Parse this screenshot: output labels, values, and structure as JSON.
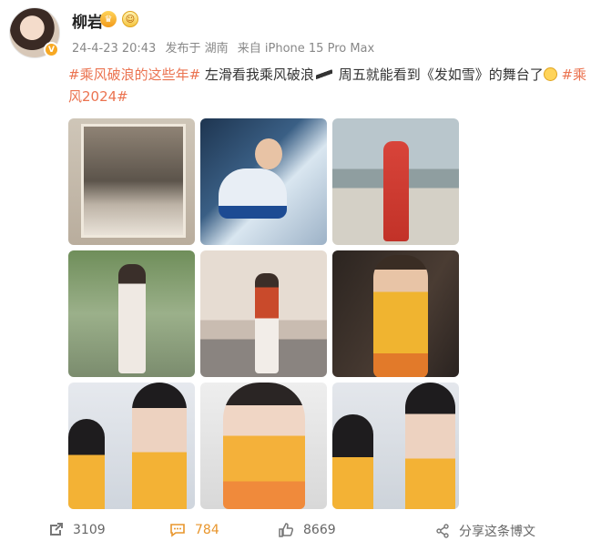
{
  "post": {
    "username": "柳岩",
    "time": "24-4-23 20:43",
    "location": "发布于 湖南",
    "source": "来自 iPhone 15 Pro Max",
    "hashtag1": "#乘风破浪的这些年#",
    "body1": " 左滑看我乘风破浪",
    "body2": " 周五就能看到《发如雪》的舞台了",
    "hashtag2": "#乘风2024#"
  },
  "photos": [
    "photo-1",
    "photo-2",
    "photo-3",
    "photo-4",
    "photo-5",
    "photo-6",
    "photo-7",
    "photo-8",
    "photo-9"
  ],
  "footer": {
    "repost_count": "3109",
    "comment_count": "784",
    "like_count": "8669",
    "share_label": "分享这条博文"
  },
  "colors": {
    "hashtag": "#eb7350",
    "comment_highlight": "#e8952b",
    "verified_badge": "#f7a823"
  },
  "icons": [
    "repost-icon",
    "comment-icon",
    "like-icon",
    "share-icon",
    "verified-badge-icon",
    "member-crown-icon",
    "fan-medal-icon"
  ]
}
